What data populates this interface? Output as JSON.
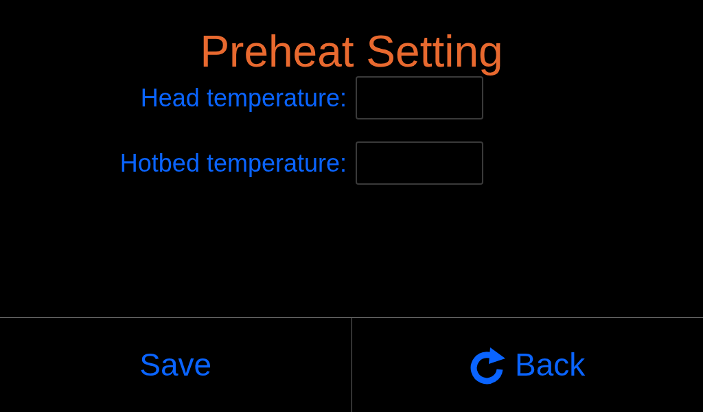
{
  "title": "Preheat Setting",
  "fields": [
    {
      "label": "Head temperature:"
    },
    {
      "label": "Hotbed temperature:"
    }
  ],
  "buttons": [
    {
      "label": "Save",
      "kind": "plain"
    },
    {
      "label": "Back",
      "kind": "back"
    }
  ]
}
